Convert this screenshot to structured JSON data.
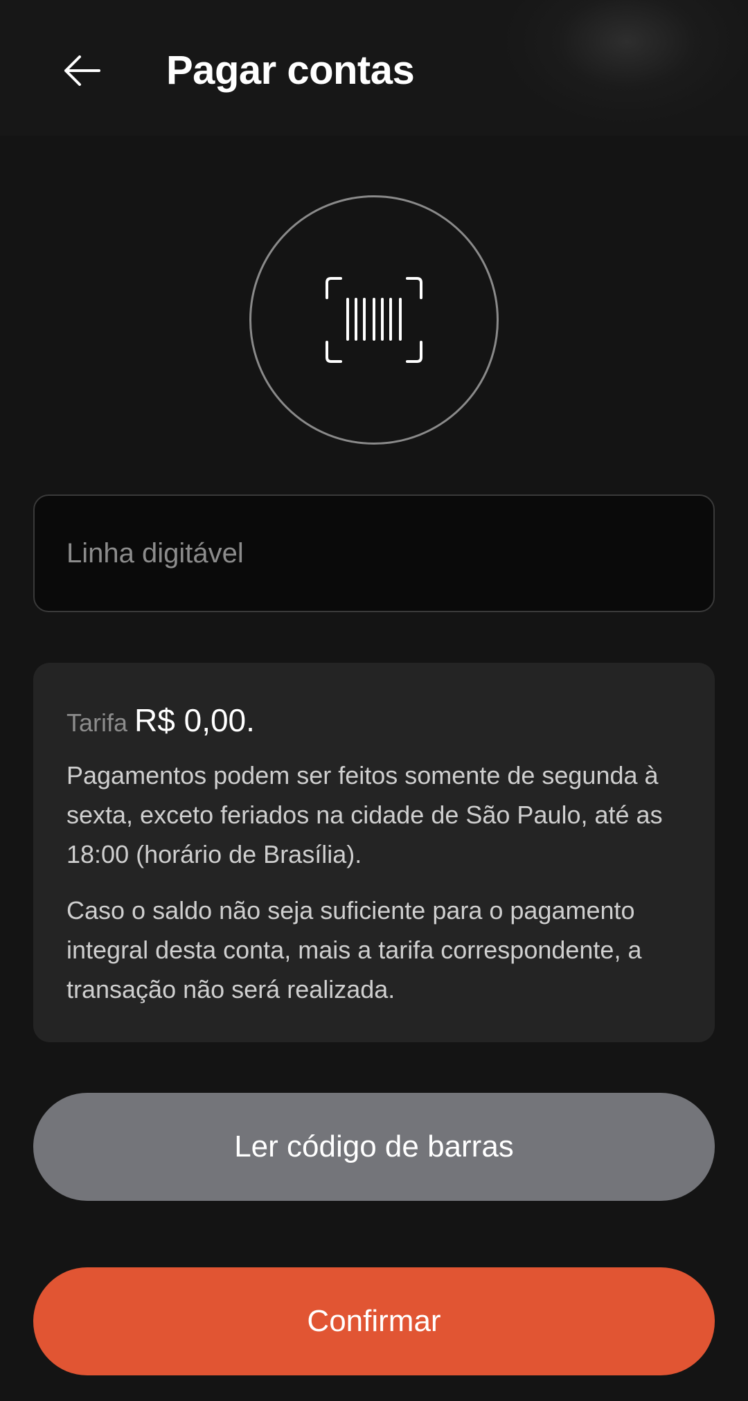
{
  "header": {
    "title": "Pagar contas",
    "back_icon": "arrow-left-icon"
  },
  "scanner": {
    "icon": "barcode-scan-icon"
  },
  "input": {
    "placeholder": "Linha digitável",
    "value": ""
  },
  "info": {
    "fee_label": "Tarifa",
    "fee_value": "R$ 0,00.",
    "paragraph_1": "Pagamentos podem ser feitos somente de segunda à sexta, exceto feriados na cidade de São Paulo, até as 18:00 (horário de Brasília).",
    "paragraph_2": "Caso o saldo não seja suficiente para o pagamento integral desta conta, mais a tarifa correspondente, a transação não será realizada."
  },
  "buttons": {
    "scan_label": "Ler código de barras",
    "confirm_label": "Confirmar"
  },
  "colors": {
    "background": "#141414",
    "card": "#242424",
    "scan_button": "#74757a",
    "confirm_button": "#e15533"
  }
}
